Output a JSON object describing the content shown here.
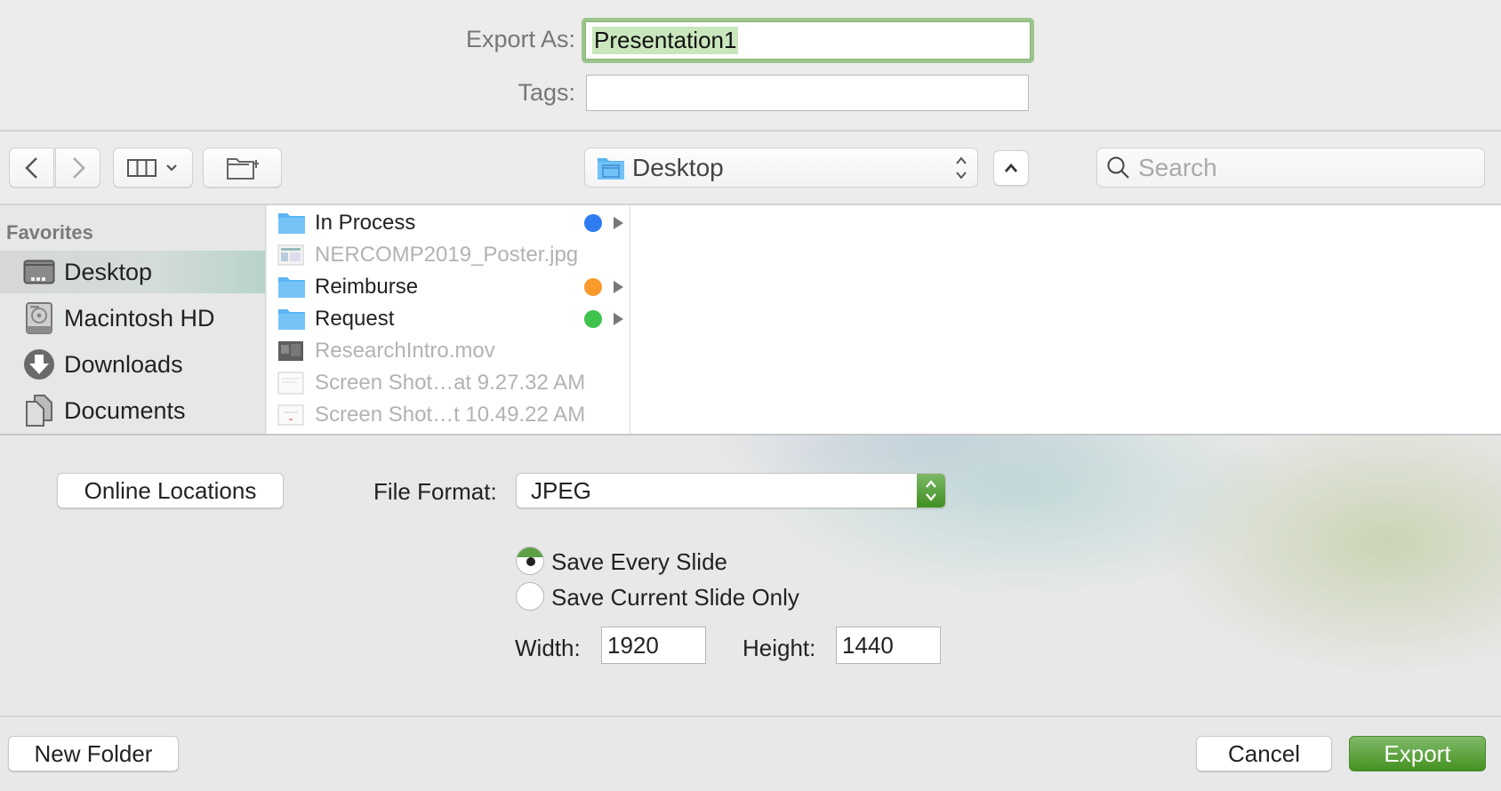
{
  "header": {
    "export_as_label": "Export As:",
    "export_as_value": "Presentation1",
    "tags_label": "Tags:",
    "tags_value": ""
  },
  "toolbar": {
    "back_icon": "chevron-left-icon",
    "forward_icon": "chevron-right-icon",
    "view_icon": "column-view-icon",
    "new_folder_icon": "folder-plus-icon",
    "location": "Desktop",
    "location_icon": "desktop-folder-icon",
    "search_placeholder": "Search"
  },
  "sidebar": {
    "heading": "Favorites",
    "items": [
      {
        "label": "Desktop",
        "icon": "desktop-icon",
        "active": true
      },
      {
        "label": "Macintosh HD",
        "icon": "hard-drive-icon",
        "active": false
      },
      {
        "label": "Downloads",
        "icon": "downloads-icon",
        "active": false
      },
      {
        "label": "Documents",
        "icon": "documents-icon",
        "active": false
      }
    ]
  },
  "files": [
    {
      "name": "In Process",
      "type": "folder",
      "tag_color": "#2f7bf0",
      "enabled": true
    },
    {
      "name": "NERCOMP2019_Poster.jpg",
      "type": "image",
      "tag_color": null,
      "enabled": false
    },
    {
      "name": "Reimburse",
      "type": "folder",
      "tag_color": "#f89a2c",
      "enabled": true
    },
    {
      "name": "Request",
      "type": "folder",
      "tag_color": "#3fc34c",
      "enabled": true
    },
    {
      "name": "ResearchIntro.mov",
      "type": "movie",
      "tag_color": null,
      "enabled": false
    },
    {
      "name": "Screen Shot…at 9.27.32 AM",
      "type": "image",
      "tag_color": null,
      "enabled": false
    },
    {
      "name": "Screen Shot…t 10.49.22 AM",
      "type": "image",
      "tag_color": null,
      "enabled": false
    }
  ],
  "options": {
    "online_locations": "Online Locations",
    "file_format_label": "File Format:",
    "file_format_value": "JPEG",
    "radio_every": "Save Every Slide",
    "radio_current": "Save Current Slide Only",
    "selected_radio": "every",
    "width_label": "Width:",
    "width_value": "1920",
    "height_label": "Height:",
    "height_value": "1440"
  },
  "footer": {
    "new_folder": "New Folder",
    "cancel": "Cancel",
    "export": "Export"
  },
  "colors": {
    "accent_green": "#4f9a2c",
    "focus_ring": "#9bc58a"
  }
}
